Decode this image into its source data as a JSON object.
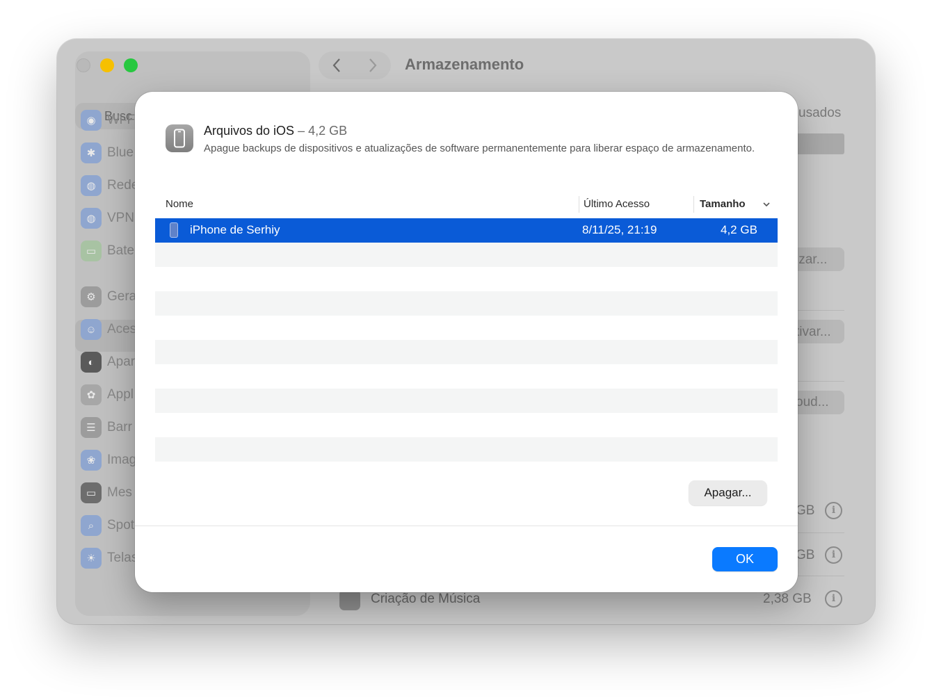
{
  "window": {
    "title": "Armazenamento",
    "search_placeholder": "Busc",
    "sidebar": [
      {
        "label": "Wi-F",
        "icon": "wifi-icon",
        "color": "#8fa6cf",
        "glyph": "◉"
      },
      {
        "label": "Blue",
        "icon": "bluetooth-icon",
        "color": "#8fa6cf",
        "glyph": "✱"
      },
      {
        "label": "Rede",
        "icon": "network-icon",
        "color": "#8fa6cf",
        "glyph": "◍"
      },
      {
        "label": "VPN",
        "icon": "vpn-icon",
        "color": "#8fa6cf",
        "glyph": "◍"
      },
      {
        "label": "Bate",
        "icon": "battery-icon",
        "color": "#a8c3a3",
        "glyph": "▭"
      },
      {
        "label": "Gera",
        "icon": "gear-icon",
        "color": "#9c9c9c",
        "glyph": "⚙"
      },
      {
        "label": "Aces",
        "icon": "accessibility-icon",
        "color": "#8fa6cf",
        "glyph": "☺"
      },
      {
        "label": "Apar",
        "icon": "appearance-icon",
        "color": "#5a5a5a",
        "glyph": "◐"
      },
      {
        "label": "Appl",
        "icon": "apple-intelligence-icon",
        "color": "#a7a7a7",
        "glyph": "✿"
      },
      {
        "label": "Barr",
        "icon": "menu-bar-icon",
        "color": "#9c9c9c",
        "glyph": "☰"
      },
      {
        "label": "Imag",
        "icon": "wallpaper-icon",
        "color": "#8fa6cf",
        "glyph": "❀"
      },
      {
        "label": "Mes",
        "icon": "desktop-dock-icon",
        "color": "#6d6d6d",
        "glyph": "▭"
      },
      {
        "label": "Spot",
        "icon": "spotlight-icon",
        "color": "#8fa6cf",
        "glyph": "⌕"
      },
      {
        "label": "Telas",
        "icon": "displays-icon",
        "color": "#8fa6cf",
        "glyph": "☀"
      }
    ],
    "main": {
      "header_fragment": "usados",
      "buttons": [
        "izar...",
        "tivar...",
        "oud..."
      ],
      "rows": [
        {
          "size_fragment": "GB"
        },
        {
          "size_fragment": "GB"
        },
        {
          "label": "Criação de Música",
          "size": "2,38 GB"
        }
      ]
    }
  },
  "dialog": {
    "title": "Arquivos do iOS",
    "size": "– 4,2 GB",
    "description": "Apague backups de dispositivos e atualizações de software permanentemente para liberar espaço de armazenamento.",
    "columns": {
      "name": "Nome",
      "last_access": "Último Acesso",
      "size": "Tamanho"
    },
    "rows": [
      {
        "name": "iPhone de Serhiy",
        "last_access": "8/11/25, 21:19",
        "size": "4,2 GB"
      }
    ],
    "delete_button": "Apagar...",
    "ok_button": "OK"
  },
  "colors": {
    "accent": "#0a7aff",
    "selection": "#0a5bd7",
    "traffic_min": "#f6c000",
    "traffic_max": "#27c840"
  }
}
